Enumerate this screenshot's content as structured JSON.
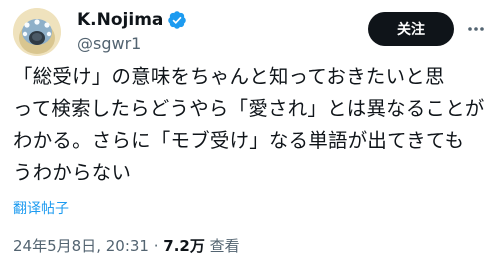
{
  "user": {
    "name": "K.Nojima",
    "handle": "@sgwr1",
    "follow_label": "关注"
  },
  "tweet": {
    "lines": [
      "「総受け」の意味をちゃんと知っておきたいと思",
      "って検索したらどうやら「愛され」とは異なることが",
      "わかる。さらに「モブ受け」なる単語が出てきても",
      "うわからない"
    ],
    "translate_label": "翻译帖子"
  },
  "meta": {
    "date": "24年5月8日",
    "separator": ", ",
    "time": "20:31",
    "dot": " · ",
    "views": "7.2万",
    "views_label": " 查看"
  },
  "colors": {
    "text": "#0f1419",
    "secondary": "#536471",
    "accent": "#1d9bf0",
    "follow_bg": "#0f1419"
  },
  "icons": {
    "verified": "verified-badge-icon",
    "more": "more-options-icon"
  }
}
